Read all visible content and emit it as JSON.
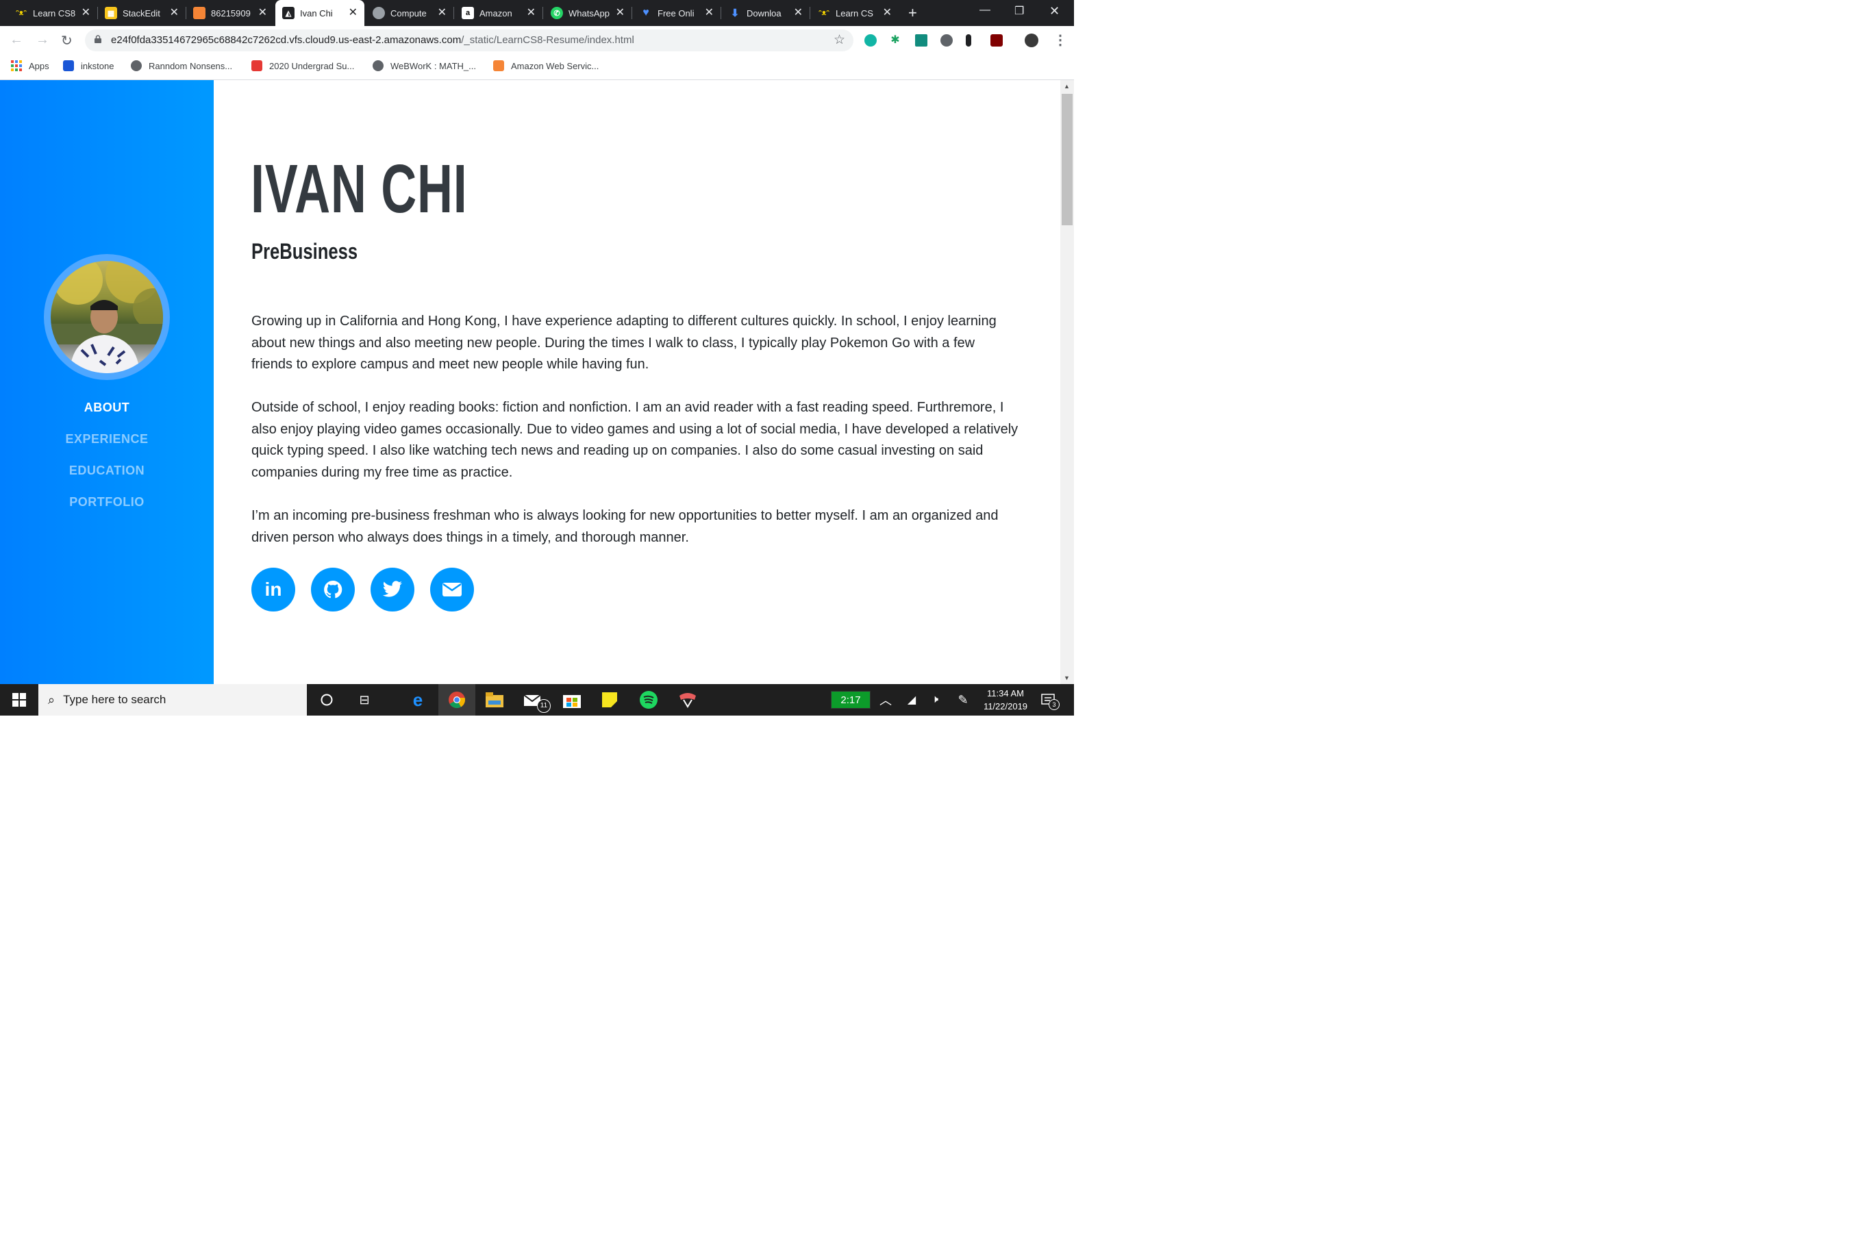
{
  "browser": {
    "tabs": [
      {
        "title": "Learn CS8",
        "active": false
      },
      {
        "title": "StackEdit",
        "active": false
      },
      {
        "title": "86215909",
        "active": false
      },
      {
        "title": "Ivan Chi",
        "active": true
      },
      {
        "title": "Compute",
        "active": false
      },
      {
        "title": "Amazon",
        "active": false
      },
      {
        "title": "WhatsApp",
        "active": false
      },
      {
        "title": "Free Onli",
        "active": false
      },
      {
        "title": "Downloa",
        "active": false
      },
      {
        "title": "Learn CS",
        "active": false
      }
    ],
    "url_host": "e24f0fda33514672965c68842c7262cd.vfs.cloud9.us-east-2.amazonaws.com",
    "url_path": "/_static/LearnCS8-Resume/index.html",
    "bookmarks": [
      "Apps",
      "inkstone",
      "Ranndom Nonsens...",
      "2020 Undergrad Su...",
      "WeBWorK : MATH_...",
      "Amazon Web Servic..."
    ]
  },
  "profile": {
    "name": "IVAN CHI",
    "subtitle": "PreBusiness",
    "paragraphs": [
      "Growing up in California and Hong Kong, I have experience adapting to different cultures quickly. In school, I enjoy learning about new things and also meeting new people. During the times I walk to class, I typically play Pokemon Go with a few friends to explore campus and meet new people while having fun.",
      "Outside of school, I enjoy reading books: fiction and nonfiction. I am an avid reader with a fast reading speed. Furthremore, I also enjoy playing video games occasionally. Due to video games and using a lot of social media, I have developed a relatively quick typing speed. I also like watching tech news and reading up on companies. I also do some casual investing on said companies during my free time as practice.",
      "I’m an incoming pre-business freshman who is always looking for new opportunities to better myself. I am an organized and driven person who always does things in a timely, and thorough manner."
    ]
  },
  "sidebar": {
    "nav": [
      {
        "label": "ABOUT",
        "active": true
      },
      {
        "label": "EXPERIENCE",
        "active": false
      },
      {
        "label": "EDUCATION",
        "active": false
      },
      {
        "label": "PORTFOLIO",
        "active": false
      }
    ]
  },
  "social": [
    {
      "icon": "linkedin-icon",
      "label": "in"
    },
    {
      "icon": "github-icon"
    },
    {
      "icon": "twitter-icon"
    },
    {
      "icon": "email-icon"
    }
  ],
  "taskbar": {
    "search_placeholder": "Type here to search",
    "battery_time": "2:17",
    "mail_badge": "11",
    "time": "11:34 AM",
    "date": "11/22/2019",
    "notifications": "3"
  },
  "colors": {
    "sidebar_start": "#0080ff",
    "sidebar_end": "#0099ff",
    "accent": "#0099ff",
    "heading": "#343a40"
  }
}
